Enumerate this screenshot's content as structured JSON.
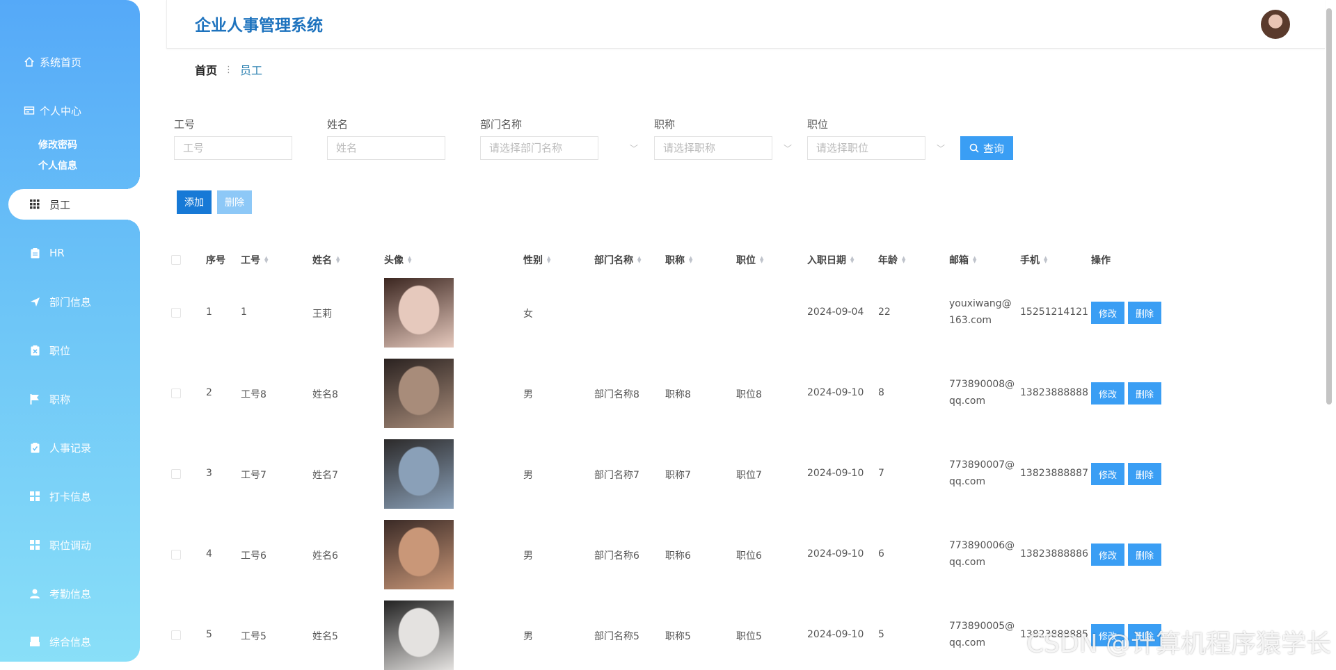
{
  "app": {
    "title": "企业人事管理系统"
  },
  "sidebar": {
    "top": [
      {
        "label": "系统首页",
        "icon": "home-icon"
      },
      {
        "label": "个人中心",
        "icon": "profile-card-icon"
      }
    ],
    "sub": [
      {
        "label": "修改密码"
      },
      {
        "label": "个人信息"
      }
    ],
    "items": [
      {
        "label": "员工",
        "icon": "grid-icon",
        "active": true
      },
      {
        "label": "HR",
        "icon": "clipboard-icon"
      },
      {
        "label": "部门信息",
        "icon": "send-icon"
      },
      {
        "label": "职位",
        "icon": "clipboard-x-icon"
      },
      {
        "label": "职称",
        "icon": "flag-icon"
      },
      {
        "label": "人事记录",
        "icon": "clipboard-check-icon"
      },
      {
        "label": "打卡信息",
        "icon": "apps-icon"
      },
      {
        "label": "职位调动",
        "icon": "apps-icon"
      },
      {
        "label": "考勤信息",
        "icon": "user-icon"
      },
      {
        "label": "综合信息",
        "icon": "printer-icon"
      }
    ]
  },
  "breadcrumb": {
    "home": "首页",
    "separator": "⋮",
    "current": "员工"
  },
  "search": {
    "fields": [
      {
        "label": "工号",
        "placeholder": "工号"
      },
      {
        "label": "姓名",
        "placeholder": "姓名"
      },
      {
        "label": "部门名称",
        "placeholder": "请选择部门名称"
      },
      {
        "label": "职称",
        "placeholder": "请选择职称"
      },
      {
        "label": "职位",
        "placeholder": "请选择职位"
      }
    ],
    "query_label": "查询"
  },
  "actions": {
    "add_label": "添加",
    "delete_label": "删除"
  },
  "table": {
    "headers": [
      "序号",
      "工号",
      "姓名",
      "头像",
      "性别",
      "部门名称",
      "职称",
      "职位",
      "入职日期",
      "年龄",
      "邮箱",
      "手机",
      "操作"
    ],
    "edit_label": "修改",
    "delete_label": "删除",
    "rows": [
      {
        "index": "1",
        "id": "1",
        "name": "王莉",
        "gender": "女",
        "dept": "",
        "title": "",
        "position": "",
        "date": "2024-09-04",
        "age": "22",
        "email": "youxiwang@163.com",
        "phone": "15251214121",
        "photo": [
          "#e6c9bd",
          "#3b2620"
        ]
      },
      {
        "index": "2",
        "id": "工号8",
        "name": "姓名8",
        "gender": "男",
        "dept": "部门名称8",
        "title": "职称8",
        "position": "职位8",
        "date": "2024-09-10",
        "age": "8",
        "email": "773890008@qq.com",
        "phone": "13823888888",
        "photo": [
          "#a88c7a",
          "#2a2220"
        ]
      },
      {
        "index": "3",
        "id": "工号7",
        "name": "姓名7",
        "gender": "男",
        "dept": "部门名称7",
        "title": "职称7",
        "position": "职位7",
        "date": "2024-09-10",
        "age": "7",
        "email": "773890007@qq.com",
        "phone": "13823888887",
        "photo": [
          "#8aa0b8",
          "#2c2a2a"
        ]
      },
      {
        "index": "4",
        "id": "工号6",
        "name": "姓名6",
        "gender": "男",
        "dept": "部门名称6",
        "title": "职称6",
        "position": "职位6",
        "date": "2024-09-10",
        "age": "6",
        "email": "773890006@qq.com",
        "phone": "13823888886",
        "photo": [
          "#c99778",
          "#3a2a26"
        ]
      },
      {
        "index": "5",
        "id": "工号5",
        "name": "姓名5",
        "gender": "男",
        "dept": "部门名称5",
        "title": "职称5",
        "position": "职位5",
        "date": "2024-09-10",
        "age": "5",
        "email": "773890005@qq.com",
        "phone": "13823888885",
        "photo": [
          "#e4e2e0",
          "#222222"
        ]
      }
    ]
  },
  "watermark": "CSDN @计算机程序猿学长",
  "colors": {
    "accent": "#3a9ef4",
    "primary": "#1779d6",
    "title": "#1e73be"
  }
}
